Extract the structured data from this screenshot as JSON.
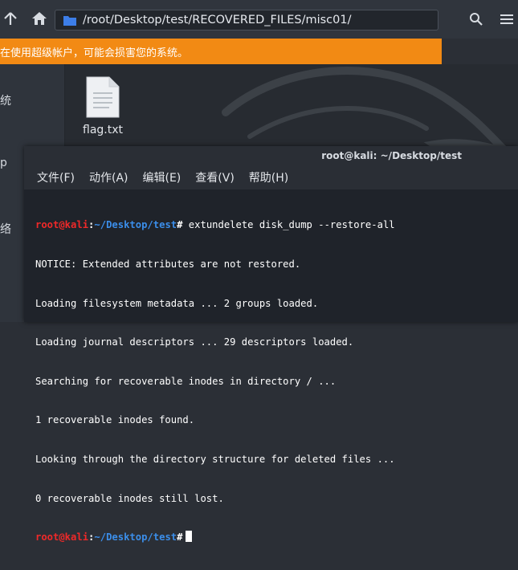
{
  "file_manager": {
    "path": "/root/Desktop/test/RECOVERED_FILES/misc01/",
    "warning": "在使用超级帐户，可能会损害您的系统。",
    "sidebar_labels": [
      "统",
      "p",
      "络"
    ],
    "files": [
      {
        "name": "flag.txt",
        "icon": "text-file-icon"
      }
    ]
  },
  "terminal": {
    "title": "root@kali: ~/Desktop/test",
    "menu": [
      "文件(F)",
      "动作(A)",
      "编辑(E)",
      "查看(V)",
      "帮助(H)"
    ],
    "prompt": {
      "user": "root@kali",
      "sep": ":",
      "path": "~/Desktop/test",
      "hash": "#"
    },
    "command": " extundelete disk_dump --restore-all",
    "output": [
      "NOTICE: Extended attributes are not restored.",
      "Loading filesystem metadata ... 2 groups loaded.",
      "Loading journal descriptors ... 29 descriptors loaded.",
      "Searching for recoverable inodes in directory / ...",
      "1 recoverable inodes found.",
      "Looking through the directory structure for deleted files ...",
      "0 recoverable inodes still lost."
    ]
  },
  "colors": {
    "warning_bg": "#f28a14",
    "prompt_user": "#ef2929",
    "prompt_path": "#3b8eea",
    "folder_icon": "#3d7ee8"
  }
}
